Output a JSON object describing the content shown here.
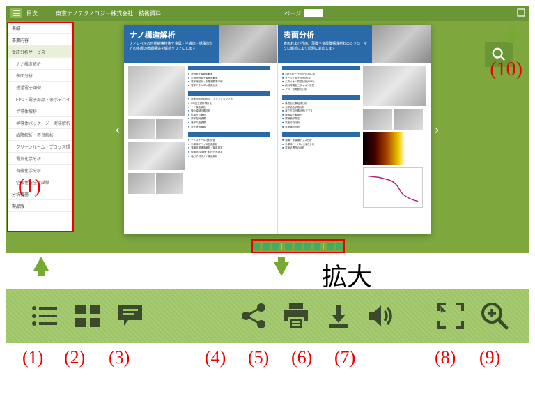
{
  "header": {
    "menu_label": "目次",
    "title": "東京ナノテクノロジー株式会社　技術資料",
    "page_label": "ページ"
  },
  "sidebar": {
    "items": [
      {
        "label": "表紙",
        "sel": false,
        "sub": false
      },
      {
        "label": "事業内容",
        "sel": false,
        "sub": false
      },
      {
        "label": "受託分析サービス",
        "sel": true,
        "sub": false
      },
      {
        "label": "ナノ構造解析",
        "sel": false,
        "sub": true
      },
      {
        "label": "表面分析",
        "sel": false,
        "sub": true
      },
      {
        "label": "透過電子顕微",
        "sel": false,
        "sub": true
      },
      {
        "label": "FPD・電子部品・表示デバイ",
        "sel": false,
        "sub": true
      },
      {
        "label": "半導体解析",
        "sel": false,
        "sub": true
      },
      {
        "label": "半導体パッケージ・実装解析",
        "sel": false,
        "sub": true
      },
      {
        "label": "故障解析・不良解析",
        "sel": false,
        "sub": true
      },
      {
        "label": "クリーンルーム・プロセス環",
        "sel": false,
        "sub": true
      },
      {
        "label": "電気化学分析",
        "sel": false,
        "sub": true
      },
      {
        "label": "有機化学分析",
        "sel": false,
        "sub": true
      },
      {
        "label": "信頼性安全性試験",
        "sel": false,
        "sub": true
      },
      {
        "label": "分析機器",
        "sel": false,
        "sub": false
      },
      {
        "label": "製品版",
        "sel": false,
        "sub": false
      }
    ]
  },
  "book": {
    "left": {
      "title": "ナノ構造解析",
      "subtitle": "ナノレベルの形態観察技術で金属・半導体・誘電体などの多層の微細構造を解析クリアにします"
    },
    "right": {
      "title": "表面分析",
      "subtitle": "表面および界面、薄膜や多層膜構成材料のミクロ・マクロ解析により問題に対応します"
    }
  },
  "search": {
    "label": "検索"
  },
  "annotations": {
    "zoom_label": "拡大",
    "n1": "(1)",
    "n10": "(10)",
    "bottom": [
      "(1)",
      "(2)",
      "(3)",
      "(4)",
      "(5)",
      "(6)",
      "(7)",
      "(8)",
      "(9)"
    ]
  },
  "toolbar": {
    "items": [
      {
        "name": "toc-icon",
        "label": "目次"
      },
      {
        "name": "thumbnails-icon",
        "label": "サムネイル"
      },
      {
        "name": "notes-icon",
        "label": "付箋"
      },
      {
        "name": "share-icon",
        "label": "共有"
      },
      {
        "name": "print-icon",
        "label": "印刷"
      },
      {
        "name": "download-icon",
        "label": "ダウンロード"
      },
      {
        "name": "sound-icon",
        "label": "音声"
      },
      {
        "name": "fullscreen-icon",
        "label": "全画面"
      },
      {
        "name": "zoom-in-icon",
        "label": "拡大"
      }
    ]
  }
}
